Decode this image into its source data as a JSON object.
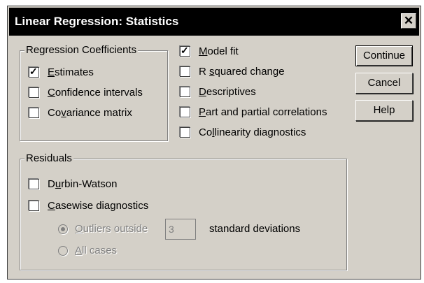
{
  "window": {
    "title": "Linear Regression: Statistics",
    "close_glyph": "✕"
  },
  "regression_coefficients": {
    "legend": "Regression Coefficients",
    "items": [
      {
        "pre": "",
        "key": "E",
        "post": "stimates",
        "checked": true
      },
      {
        "pre": "",
        "key": "C",
        "post": "onfidence intervals",
        "checked": false
      },
      {
        "pre": "Co",
        "key": "v",
        "post": "ariance matrix",
        "checked": false
      }
    ]
  },
  "options": [
    {
      "pre": "",
      "key": "M",
      "post": "odel fit",
      "checked": true
    },
    {
      "pre": "R ",
      "key": "s",
      "post": "quared change",
      "checked": false
    },
    {
      "pre": "",
      "key": "D",
      "post": "escriptives",
      "checked": false
    },
    {
      "pre": "",
      "key": "P",
      "post": "art and partial correlations",
      "checked": false
    },
    {
      "pre": "Co",
      "key": "l",
      "post": "linearity diagnostics",
      "checked": false
    }
  ],
  "buttons": {
    "continue": "Continue",
    "cancel": "Cancel",
    "help": "Help"
  },
  "residuals": {
    "legend": "Residuals",
    "durbin": {
      "pre": "D",
      "key": "u",
      "post": "rbin-Watson",
      "checked": false
    },
    "casewise": {
      "pre": "",
      "key": "C",
      "post": "asewise diagnostics",
      "checked": false
    },
    "outliers": {
      "pre": "",
      "key": "O",
      "post": "utliers outside",
      "selected": true,
      "enabled": false
    },
    "outliers_value": "3",
    "std_dev_label": "standard deviations",
    "all_cases": {
      "pre": "",
      "key": "A",
      "post": "ll cases",
      "selected": false,
      "enabled": false
    }
  },
  "check_glyph": "✓"
}
